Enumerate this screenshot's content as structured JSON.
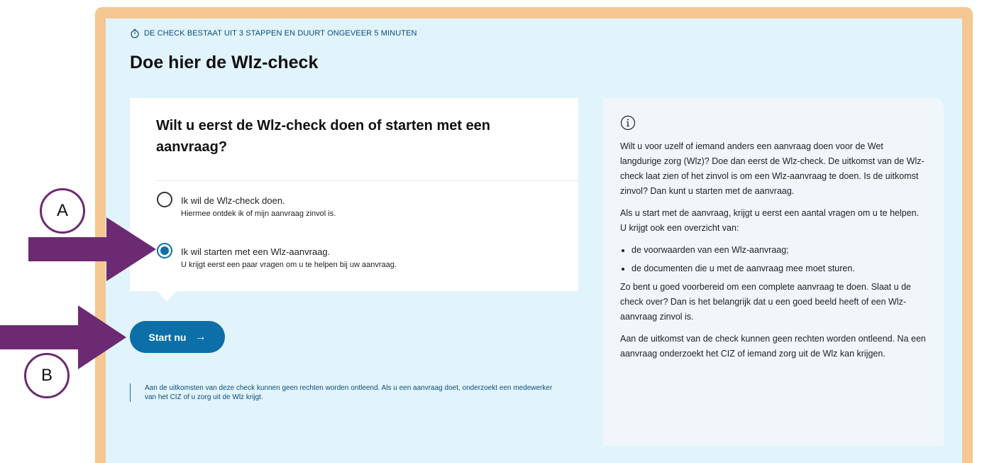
{
  "header": {
    "duration_text": "DE CHECK BESTAAT UIT 3 STAPPEN EN DUURT ONGEVEER 5 MINUTEN",
    "title": "Doe hier de Wlz-check"
  },
  "question": {
    "title": "Wilt u eerst de Wlz-check doen of starten met een aanvraag?",
    "options": [
      {
        "label": "Ik wil de Wlz-check doen.",
        "description": "Hiermee ontdek ik of mijn aanvraag zinvol is.",
        "selected": false
      },
      {
        "label": "Ik wil starten met een Wlz-aanvraag.",
        "description": "U krijgt eerst een paar vragen om u te helpen bij uw aanvraag.",
        "selected": true
      }
    ]
  },
  "start_button": {
    "label": "Start nu",
    "arrow": "→"
  },
  "disclaimer": "Aan de uitkomsten van deze check kunnen geen rechten worden ontleend. Als u een aanvraag doet, onderzoekt een medewerker van het CIZ of u zorg uit de Wlz krijgt.",
  "info_panel": {
    "paragraph_1": "Wilt u voor uzelf of iemand anders een aanvraag doen voor de Wet langdurige zorg (Wlz)? Doe dan eerst de Wlz-check. De uitkomst van de Wlz-check laat zien of het zinvol is om een Wlz-aanvraag te doen. Is de uitkomst zinvol? Dan kunt u starten met de aanvraag.",
    "paragraph_2": "Als u start met de aanvraag, krijgt u eerst een aantal vragen om u te helpen. U krijgt ook een overzicht van:",
    "bullets": [
      "de voorwaarden van een Wlz-aanvraag;",
      "de documenten die u met de aanvraag mee moet sturen."
    ],
    "paragraph_3": "Zo bent u goed voorbereid om een complete aanvraag te doen. Slaat u de check over? Dan is het belangrijk dat u een goed beeld heeft of een Wlz-aanvraag zinvol is.",
    "paragraph_4": "Aan de uitkomst van de check kunnen geen rechten worden ontleend. Na een aanvraag onderzoekt het CIZ of iemand zorg uit de Wlz kan krijgen."
  },
  "annotations": {
    "a_label": "A",
    "b_label": "B"
  },
  "colors": {
    "frame": "#f5c793",
    "background": "#e1f3fb",
    "primary": "#0c6fa8",
    "annotation": "#6c2a72"
  }
}
